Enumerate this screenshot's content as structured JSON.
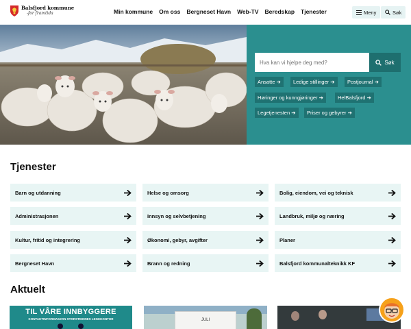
{
  "header": {
    "logo": {
      "name": "Balsfjord kommune",
      "tagline": "-for framtida"
    },
    "nav": [
      "Min kommune",
      "Om oss",
      "Bergneset Havn",
      "Web-TV",
      "Beredskap",
      "Tjenester"
    ],
    "menu_label": "Meny",
    "search_label": "Søk"
  },
  "hero": {
    "search_placeholder": "Hva kan vi hjelpe deg med?",
    "search_button": "Søk",
    "quick_links": [
      "Ansatte",
      "Ledige stillinger",
      "Postjournal",
      "Høringer og kunngjøringer",
      "HelBalsfjord",
      "Legetjenesten",
      "Priser og gebyrer"
    ]
  },
  "services": {
    "title": "Tjenester",
    "items": [
      "Barn og utdanning",
      "Helse og omsorg",
      "Bolig, eiendom, vei og teknisk",
      "Administrasjonen",
      "Innsyn og selvbetjening",
      "Landbruk, miljø og næring",
      "Kultur, fritid og integrering",
      "Økonomi, gebyr, avgifter",
      "Planer",
      "Bergneset Havn",
      "Brann og redning",
      "Balsfjord kommunalteknikk KF"
    ]
  },
  "news": {
    "title": "Aktuelt",
    "card1_title": "TIL VÅRE INNBYGGERE",
    "card1_subtitle": "KONTAKTINFORMASJON STORSTEINNES LEGEKONTOR",
    "card2_month": "JULI"
  },
  "colors": {
    "teal": "#2b8f8f",
    "teal_dark": "#1f7272",
    "service_bg": "#e8f5f4"
  }
}
